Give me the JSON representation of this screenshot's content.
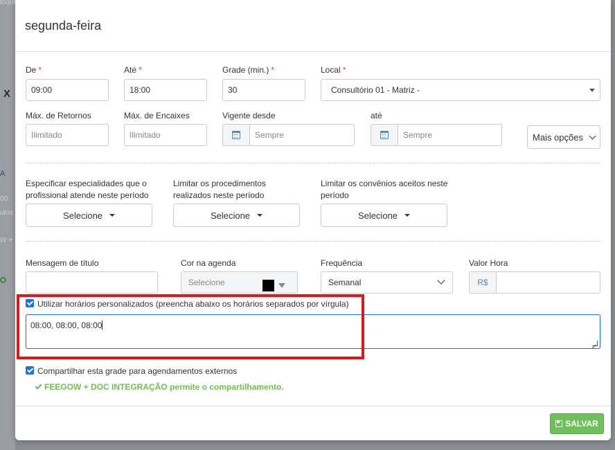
{
  "background": {
    "snippet_top": "toque",
    "close_glyph": "X",
    "tab_letter": "A",
    "snippet_1": "00.",
    "snippet_2": "utos",
    "snippet_3": "W +"
  },
  "modal": {
    "title": "segunda-feira",
    "fields": {
      "de": {
        "label": "De",
        "value": "09:00"
      },
      "ate": {
        "label": "Até",
        "value": "18:00"
      },
      "grade": {
        "label": "Grade (min.)",
        "value": "30"
      },
      "local": {
        "label": "Local",
        "value": "Consultório 01 - Matriz -"
      },
      "max_retornos": {
        "label": "Máx. de Retornos",
        "placeholder": "Ilimitado"
      },
      "max_encaixes": {
        "label": "Máx. de Encaixes",
        "placeholder": "Ilimitado"
      },
      "vigente_desde": {
        "label": "Vigente desde",
        "placeholder": "Sempre"
      },
      "vigente_ate": {
        "label": "até",
        "placeholder": "Sempre"
      }
    },
    "mais_opcoes": "Mais opções",
    "filters": {
      "especialidades_label": "Especificar especialidades que o profissional atende neste período",
      "procedimentos_label": "Limitar os procedimentos realizados neste período",
      "convenios_label": "Limitar os convênios aceitos neste período",
      "select_label": "Selecione"
    },
    "extras": {
      "mensagem_label": "Mensagem de título",
      "cor_label": "Cor na agenda",
      "cor_value": "Selecione",
      "cor_swatch": "#000000",
      "frequencia_label": "Frequência",
      "frequencia_value": "Semanal",
      "valor_label": "Valor Hora",
      "valor_prefix": "R$"
    },
    "custom_hours": {
      "checked": true,
      "label": "Utilizar horários personalizados (preencha abaixo os horários separados por vírgula)",
      "value": "08:00, 08:00, 08:00"
    },
    "share": {
      "checked": true,
      "label": "Compartilhar esta grade para agendamentos externos",
      "note": "FEEGOW + DOC INTEGRAÇÃO permite o compartilhamento."
    },
    "save_label": "SALVAR"
  },
  "colors": {
    "required": "#e03b3b",
    "accent": "#1a73e8",
    "save_green": "#6fc05b",
    "highlight_red": "#e01717",
    "note_green": "#6fbf4f"
  }
}
